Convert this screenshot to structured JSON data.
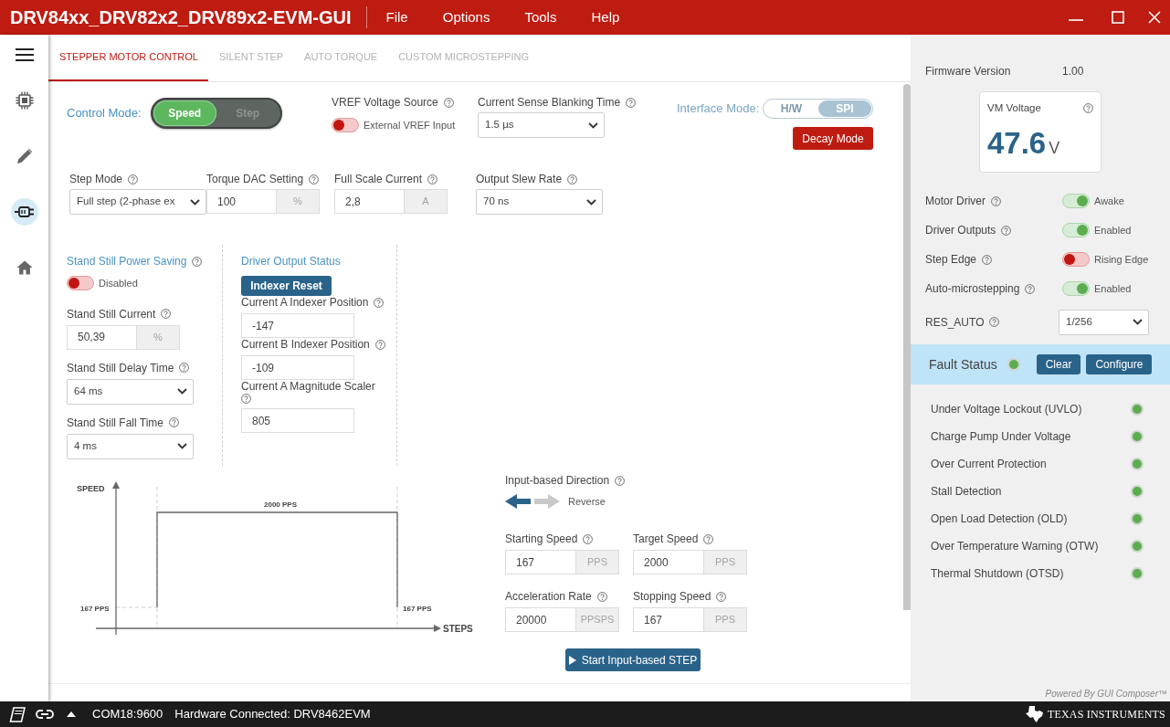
{
  "window": {
    "title": "DRV84xx_DRV82x2_DRV89x2-EVM-GUI",
    "menu": [
      "File",
      "Options",
      "Tools",
      "Help"
    ]
  },
  "sidebar": {
    "items": [
      {
        "kind": "menu",
        "selected": false
      },
      {
        "kind": "chip",
        "selected": false
      },
      {
        "kind": "pencil",
        "selected": false
      },
      {
        "kind": "plug",
        "selected": true
      },
      {
        "kind": "home",
        "selected": false
      }
    ]
  },
  "tabs": [
    {
      "label": "STEPPER MOTOR CONTROL",
      "selected": true
    },
    {
      "label": "SILENT STEP",
      "selected": false
    },
    {
      "label": "AUTO TORQUE",
      "selected": false
    },
    {
      "label": "CUSTOM MICROSTEPPING",
      "selected": false
    }
  ],
  "control_mode": {
    "label": "Control Mode:",
    "options": [
      {
        "label": "Speed",
        "selected": true
      },
      {
        "label": "Step",
        "selected": false
      }
    ]
  },
  "vref_source": {
    "label": "VREF Voltage Source",
    "on": false,
    "state_text": "External VREF Input"
  },
  "blanking_time": {
    "label": "Current Sense Blanking Time",
    "value": "1.5 µs"
  },
  "interface_mode": {
    "label": "Interface Mode:",
    "disabled": true,
    "options": [
      {
        "label": "H/W",
        "selected": false
      },
      {
        "label": "SPI",
        "selected": true
      }
    ]
  },
  "decay_mode_button": "Decay Mode",
  "settings": [
    {
      "kind": "select",
      "label": "Step Mode",
      "value": "Full step (2-phase ex"
    },
    {
      "kind": "unit_input",
      "label": "Torque DAC Setting",
      "value": "100",
      "unit": "%"
    },
    {
      "kind": "unit_input",
      "label": "Full Scale Current",
      "value": "2,8",
      "unit": "A"
    },
    {
      "kind": "select",
      "label": "Output Slew Rate",
      "value": "70 ns"
    }
  ],
  "stand_still": {
    "title": "Stand Still Power Saving",
    "on": false,
    "state_text": "Disabled",
    "fields": [
      {
        "kind": "unit_input",
        "label": "Stand Still Current",
        "value": "50,39",
        "unit": "%"
      },
      {
        "kind": "select",
        "label": "Stand Still Delay Time",
        "value": "64 ms"
      },
      {
        "kind": "select",
        "label": "Stand Still Fall Time",
        "value": "4 ms"
      }
    ]
  },
  "driver_output_status": {
    "title": "Driver Output Status",
    "button": "Indexer Reset",
    "fields": [
      {
        "label": "Current A Indexer Position",
        "value": "-147"
      },
      {
        "label": "Current B Indexer Position",
        "value": "-109"
      },
      {
        "label": "Current A Magnitude Scaler",
        "value": "805"
      }
    ]
  },
  "speed_profile": {
    "y_axis_label": "SPEED",
    "x_axis_label": "STEPS",
    "target_speed_label": "2000 PPS",
    "start_speed_label": "167 PPS",
    "stop_speed_label": "167 PPS"
  },
  "direction": {
    "label": "Input-based Direction",
    "reverse": true,
    "state_text": "Reverse"
  },
  "speed_fields": [
    {
      "label": "Starting Speed",
      "value": "167",
      "unit": "PPS"
    },
    {
      "label": "Target Speed",
      "value": "2000",
      "unit": "PPS"
    },
    {
      "label": "Acceleration Rate",
      "value": "20000",
      "unit": "PPSPS"
    },
    {
      "label": "Stopping Speed",
      "value": "167",
      "unit": "PPS"
    }
  ],
  "start_button": "Start Input-based STEP",
  "firmware": {
    "label": "Firmware Version",
    "value": "1.00"
  },
  "vm_voltage": {
    "label": "VM Voltage",
    "value": "47.6",
    "unit": "V"
  },
  "switches": [
    {
      "label": "Motor Driver",
      "on": true,
      "state_text": "Awake"
    },
    {
      "label": "Driver Outputs",
      "on": true,
      "state_text": "Enabled"
    },
    {
      "label": "Step Edge",
      "on": false,
      "state_text": "Rising Edge"
    },
    {
      "label": "Auto-microstepping",
      "on": true,
      "state_text": "Enabled"
    }
  ],
  "res_auto": {
    "label": "RES_AUTO",
    "value": "1/256"
  },
  "fault_status": {
    "title": "Fault Status",
    "color": "#5cad4f",
    "buttons": [
      "Clear",
      "Configure"
    ],
    "items": [
      {
        "label": "Under Voltage Lockout (UVLO)",
        "color": "#5cad4f"
      },
      {
        "label": "Charge Pump Under Voltage",
        "color": "#5cad4f"
      },
      {
        "label": "Over Current Protection",
        "color": "#5cad4f"
      },
      {
        "label": "Stall Detection",
        "color": "#5cad4f"
      },
      {
        "label": "Open Load Detection (OLD)",
        "color": "#5cad4f"
      },
      {
        "label": "Over Temperature Warning (OTW)",
        "color": "#5cad4f"
      },
      {
        "label": "Thermal Shutdown (OTSD)",
        "color": "#5cad4f"
      }
    ]
  },
  "powered_by": "Powered By GUI Composer™",
  "status_bar": {
    "port": "COM18:9600",
    "connection": "Hardware Connected: DRV8462EVM",
    "brand": "TEXAS INSTRUMENTS"
  }
}
